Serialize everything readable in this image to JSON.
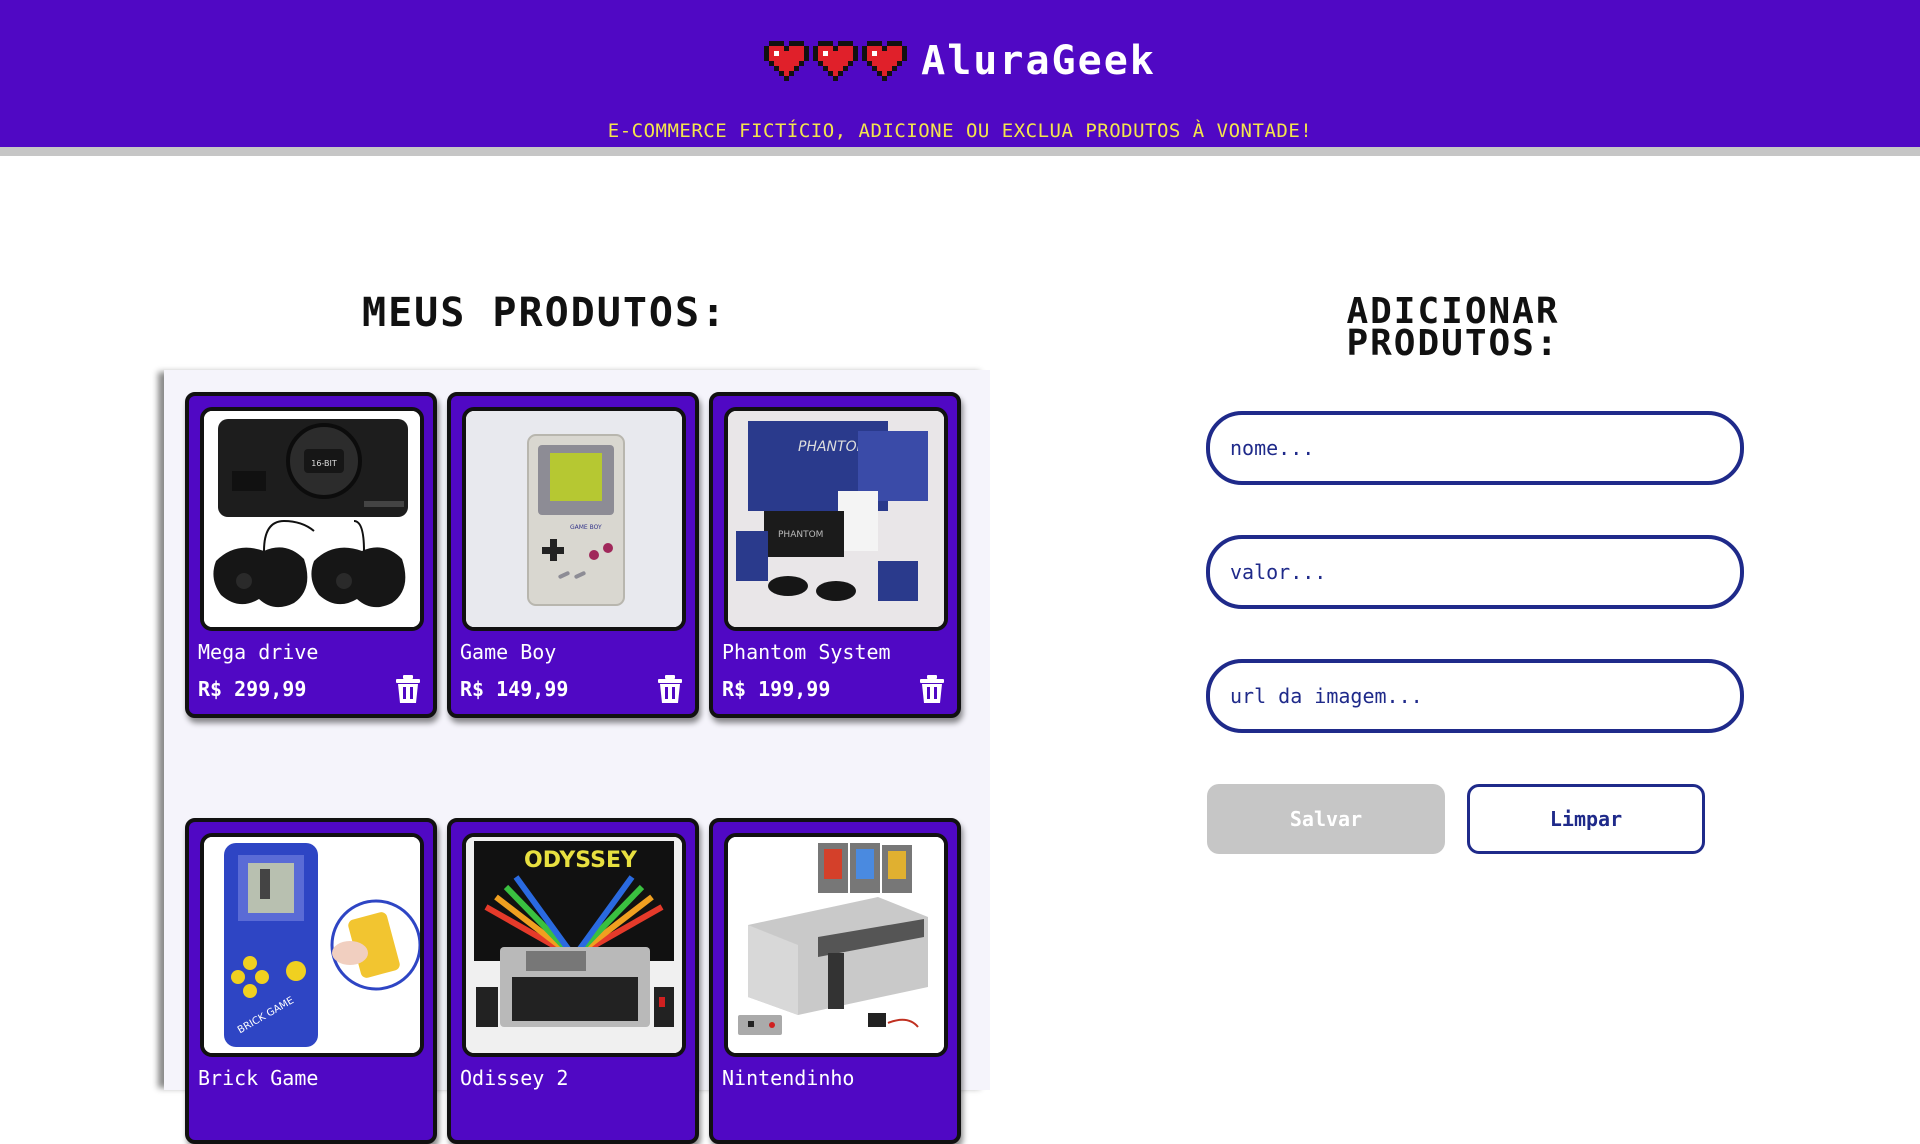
{
  "header": {
    "brand": "AluraGeek",
    "tagline": "E-COMMERCE FICTÍCIO, ADICIONE OU EXCLUA PRODUTOS À VONTADE!",
    "hearts": [
      "heart-icon",
      "heart-icon",
      "heart-icon"
    ]
  },
  "products_section": {
    "title": "MEUS PRODUTOS:",
    "products": [
      {
        "name": "Mega drive",
        "price": "R$ 299,99",
        "image": "mega-drive-console"
      },
      {
        "name": "Game Boy",
        "price": "R$ 149,99",
        "image": "game-boy-handheld"
      },
      {
        "name": "Phantom System",
        "price": "R$ 199,99",
        "image": "phantom-system-console"
      },
      {
        "name": "Brick Game",
        "price": "",
        "image": "brick-game-handheld"
      },
      {
        "name": "Odissey 2",
        "price": "",
        "image": "odyssey-2-console"
      },
      {
        "name": "Nintendinho",
        "price": "",
        "image": "nes-console"
      }
    ]
  },
  "form": {
    "title": "ADICIONAR PRODUTOS:",
    "name_placeholder": "nome...",
    "value_placeholder": "valor...",
    "url_placeholder": "url da imagem...",
    "save_label": "Salvar",
    "clear_label": "Limpar"
  },
  "colors": {
    "header_bg": "#5008c4",
    "tagline": "#f4e54c",
    "card_bg": "#5008c4",
    "field_border": "#1f2a8a",
    "save_bg": "#c6c6c6"
  }
}
